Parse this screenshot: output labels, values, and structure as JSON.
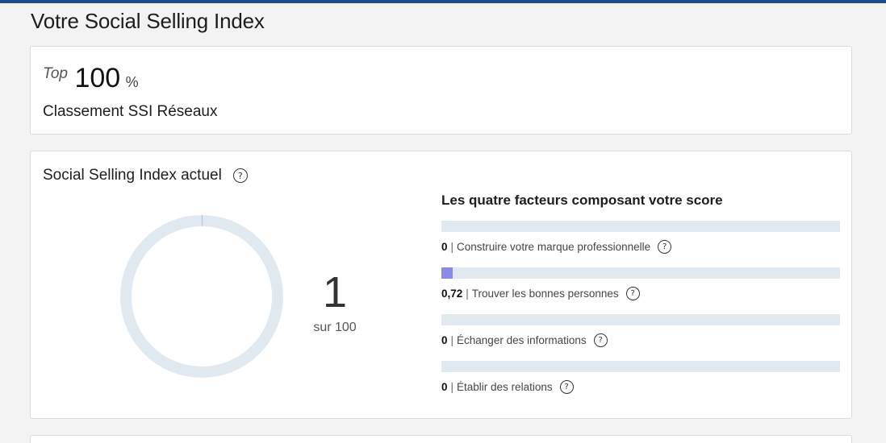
{
  "page": {
    "title": "Votre Social Selling Index",
    "accent_color": "#1f4e8c"
  },
  "ranking": {
    "prefix": "Top",
    "value": "100",
    "unit": "%",
    "label": "Classement SSI Réseaux"
  },
  "ssi": {
    "title": "Social Selling Index actuel",
    "help_icon": "help-circle-icon",
    "score": "1",
    "score_fraction": 0.01,
    "score_sub": "sur 100",
    "donut_track_color": "#e1e9f0",
    "donut_fill_color": "#8a8ae6"
  },
  "factors": {
    "title": "Les quatre facteurs composant votre score",
    "bar_color": "#8a8ae6",
    "track_color": "#e1e9f0",
    "items": [
      {
        "value": "0",
        "separator": "|",
        "label": "Construire votre marque professionnelle",
        "fraction": 0
      },
      {
        "value": "0,72",
        "separator": "|",
        "label": "Trouver les bonnes personnes",
        "fraction": 0.0288
      },
      {
        "value": "0",
        "separator": "|",
        "label": "Échanger des informations",
        "fraction": 0
      },
      {
        "value": "0",
        "separator": "|",
        "label": "Établir des relations",
        "fraction": 0
      }
    ]
  }
}
